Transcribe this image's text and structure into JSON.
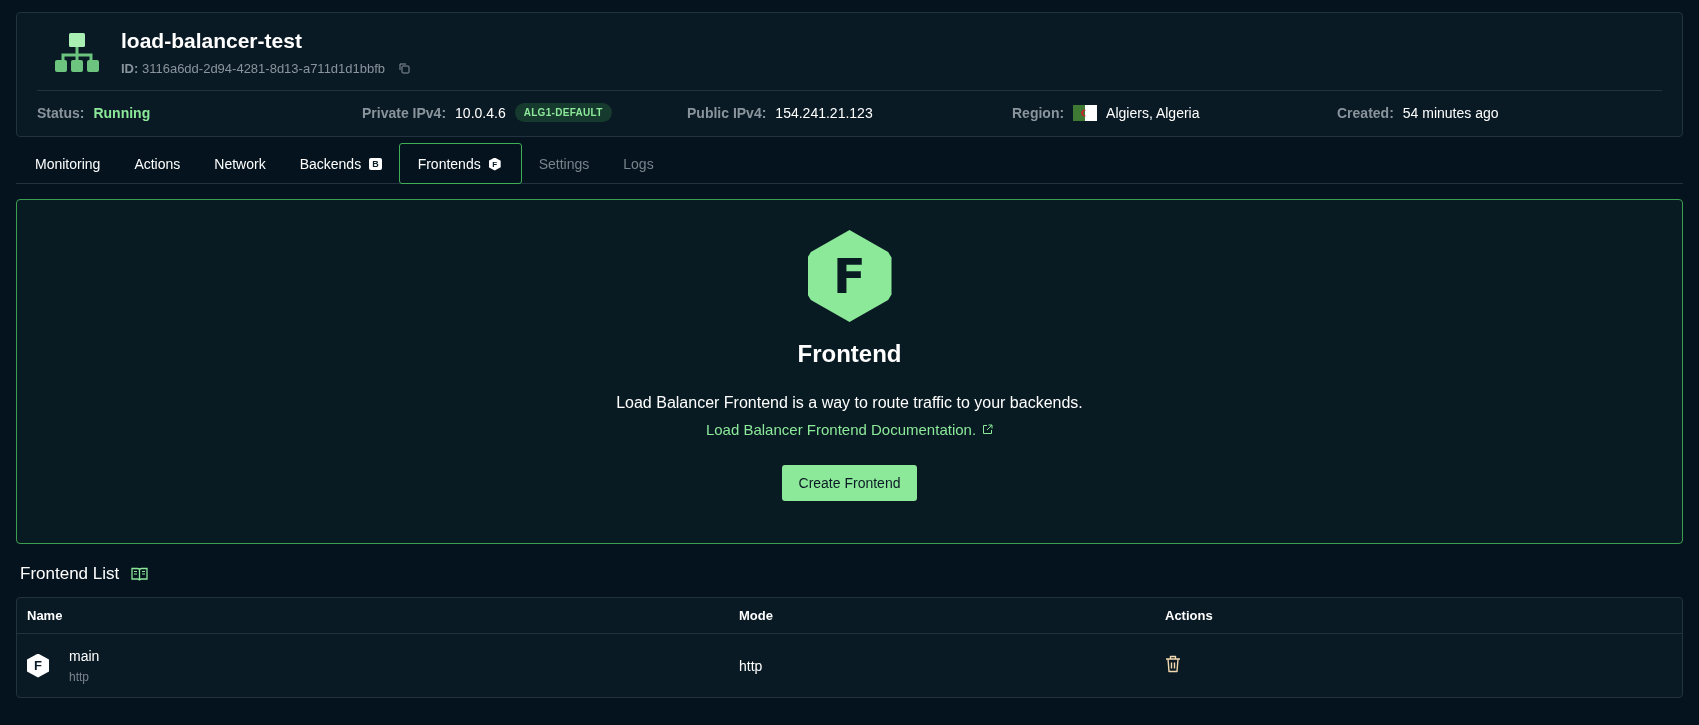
{
  "resource": {
    "name": "load-balancer-test",
    "id_label": "ID:",
    "id": "3116a6dd-2d94-4281-8d13-a711d1d1bbfb"
  },
  "details": [
    {
      "label": "Status:",
      "value": "Running",
      "kind": "status"
    },
    {
      "label": "Private IPv4:",
      "value": "10.0.4.6",
      "kind": "tag",
      "tag": "ALG1-DEFAULT"
    },
    {
      "label": "Public IPv4:",
      "value": "154.241.21.123",
      "kind": "text"
    },
    {
      "label": "Region:",
      "value": "Algiers, Algeria",
      "kind": "flag"
    },
    {
      "label": "Created:",
      "value": "54 minutes ago",
      "kind": "text"
    }
  ],
  "tabs": [
    {
      "label": "Monitoring",
      "selected": false,
      "disabled": false
    },
    {
      "label": "Actions",
      "selected": false,
      "disabled": false
    },
    {
      "label": "Network",
      "selected": false,
      "disabled": false
    },
    {
      "label": "Backends",
      "badge": "B",
      "selected": false,
      "disabled": false
    },
    {
      "label": "Frontends",
      "badge": "F",
      "selected": true,
      "disabled": false
    },
    {
      "label": "Settings",
      "selected": false,
      "disabled": true
    },
    {
      "label": "Logs",
      "selected": false,
      "disabled": true
    }
  ],
  "empty_state": {
    "icon_letter": "F",
    "title": "Frontend",
    "description": "Load Balancer Frontend is a way to route traffic to your backends.",
    "link": "Load Balancer Frontend Documentation.",
    "button": "Create Frontend"
  },
  "frontend_list": {
    "title": "Frontend List",
    "columns": [
      "Name",
      "Mode",
      "Actions"
    ],
    "rows": [
      {
        "icon_letter": "F",
        "name": "main",
        "subtitle": "http",
        "mode": "http"
      }
    ]
  }
}
